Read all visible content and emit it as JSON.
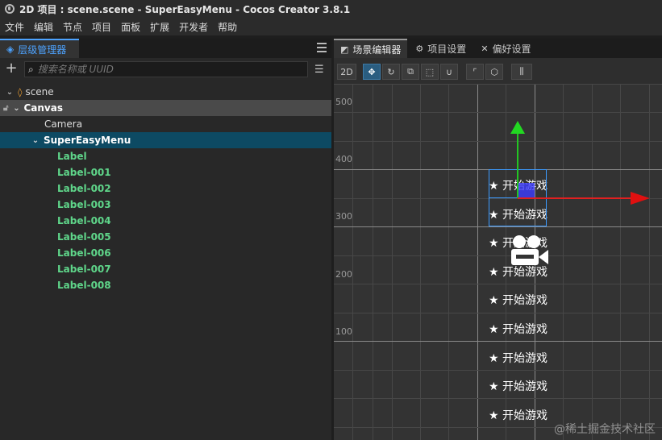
{
  "window": {
    "title": "2D 项目 : scene.scene - SuperEasyMenu - Cocos Creator 3.8.1"
  },
  "menubar": {
    "items": [
      "文件",
      "编辑",
      "节点",
      "项目",
      "面板",
      "扩展",
      "开发者",
      "帮助"
    ]
  },
  "hierarchy": {
    "tab_label": "层级管理器",
    "search_placeholder": "搜索名称或 UUID",
    "nodes": {
      "scene": "scene",
      "canvas": "Canvas",
      "camera": "Camera",
      "menu": "SuperEasyMenu",
      "labels": [
        "Label",
        "Label-001",
        "Label-002",
        "Label-003",
        "Label-004",
        "Label-005",
        "Label-006",
        "Label-007",
        "Label-008"
      ]
    },
    "selected_node": "SuperEasyMenu",
    "label_color": "#5fd68a",
    "selection_color": "#0d4a63"
  },
  "scene_editor": {
    "tabs": [
      "场景编辑器",
      "项目设置",
      "偏好设置"
    ],
    "active_tab": "场景编辑器",
    "mode_button": "2D",
    "ruler_labels": [
      "500",
      "400",
      "300",
      "200",
      "100"
    ],
    "menu_item_text": "★ 开始游戏",
    "menu_item_count": 9,
    "gizmo_colors": {
      "x_axis": "#e02020",
      "y_axis": "#22c522",
      "selection": "#3d9bff"
    }
  },
  "watermark": "@稀土掘金技术社区"
}
